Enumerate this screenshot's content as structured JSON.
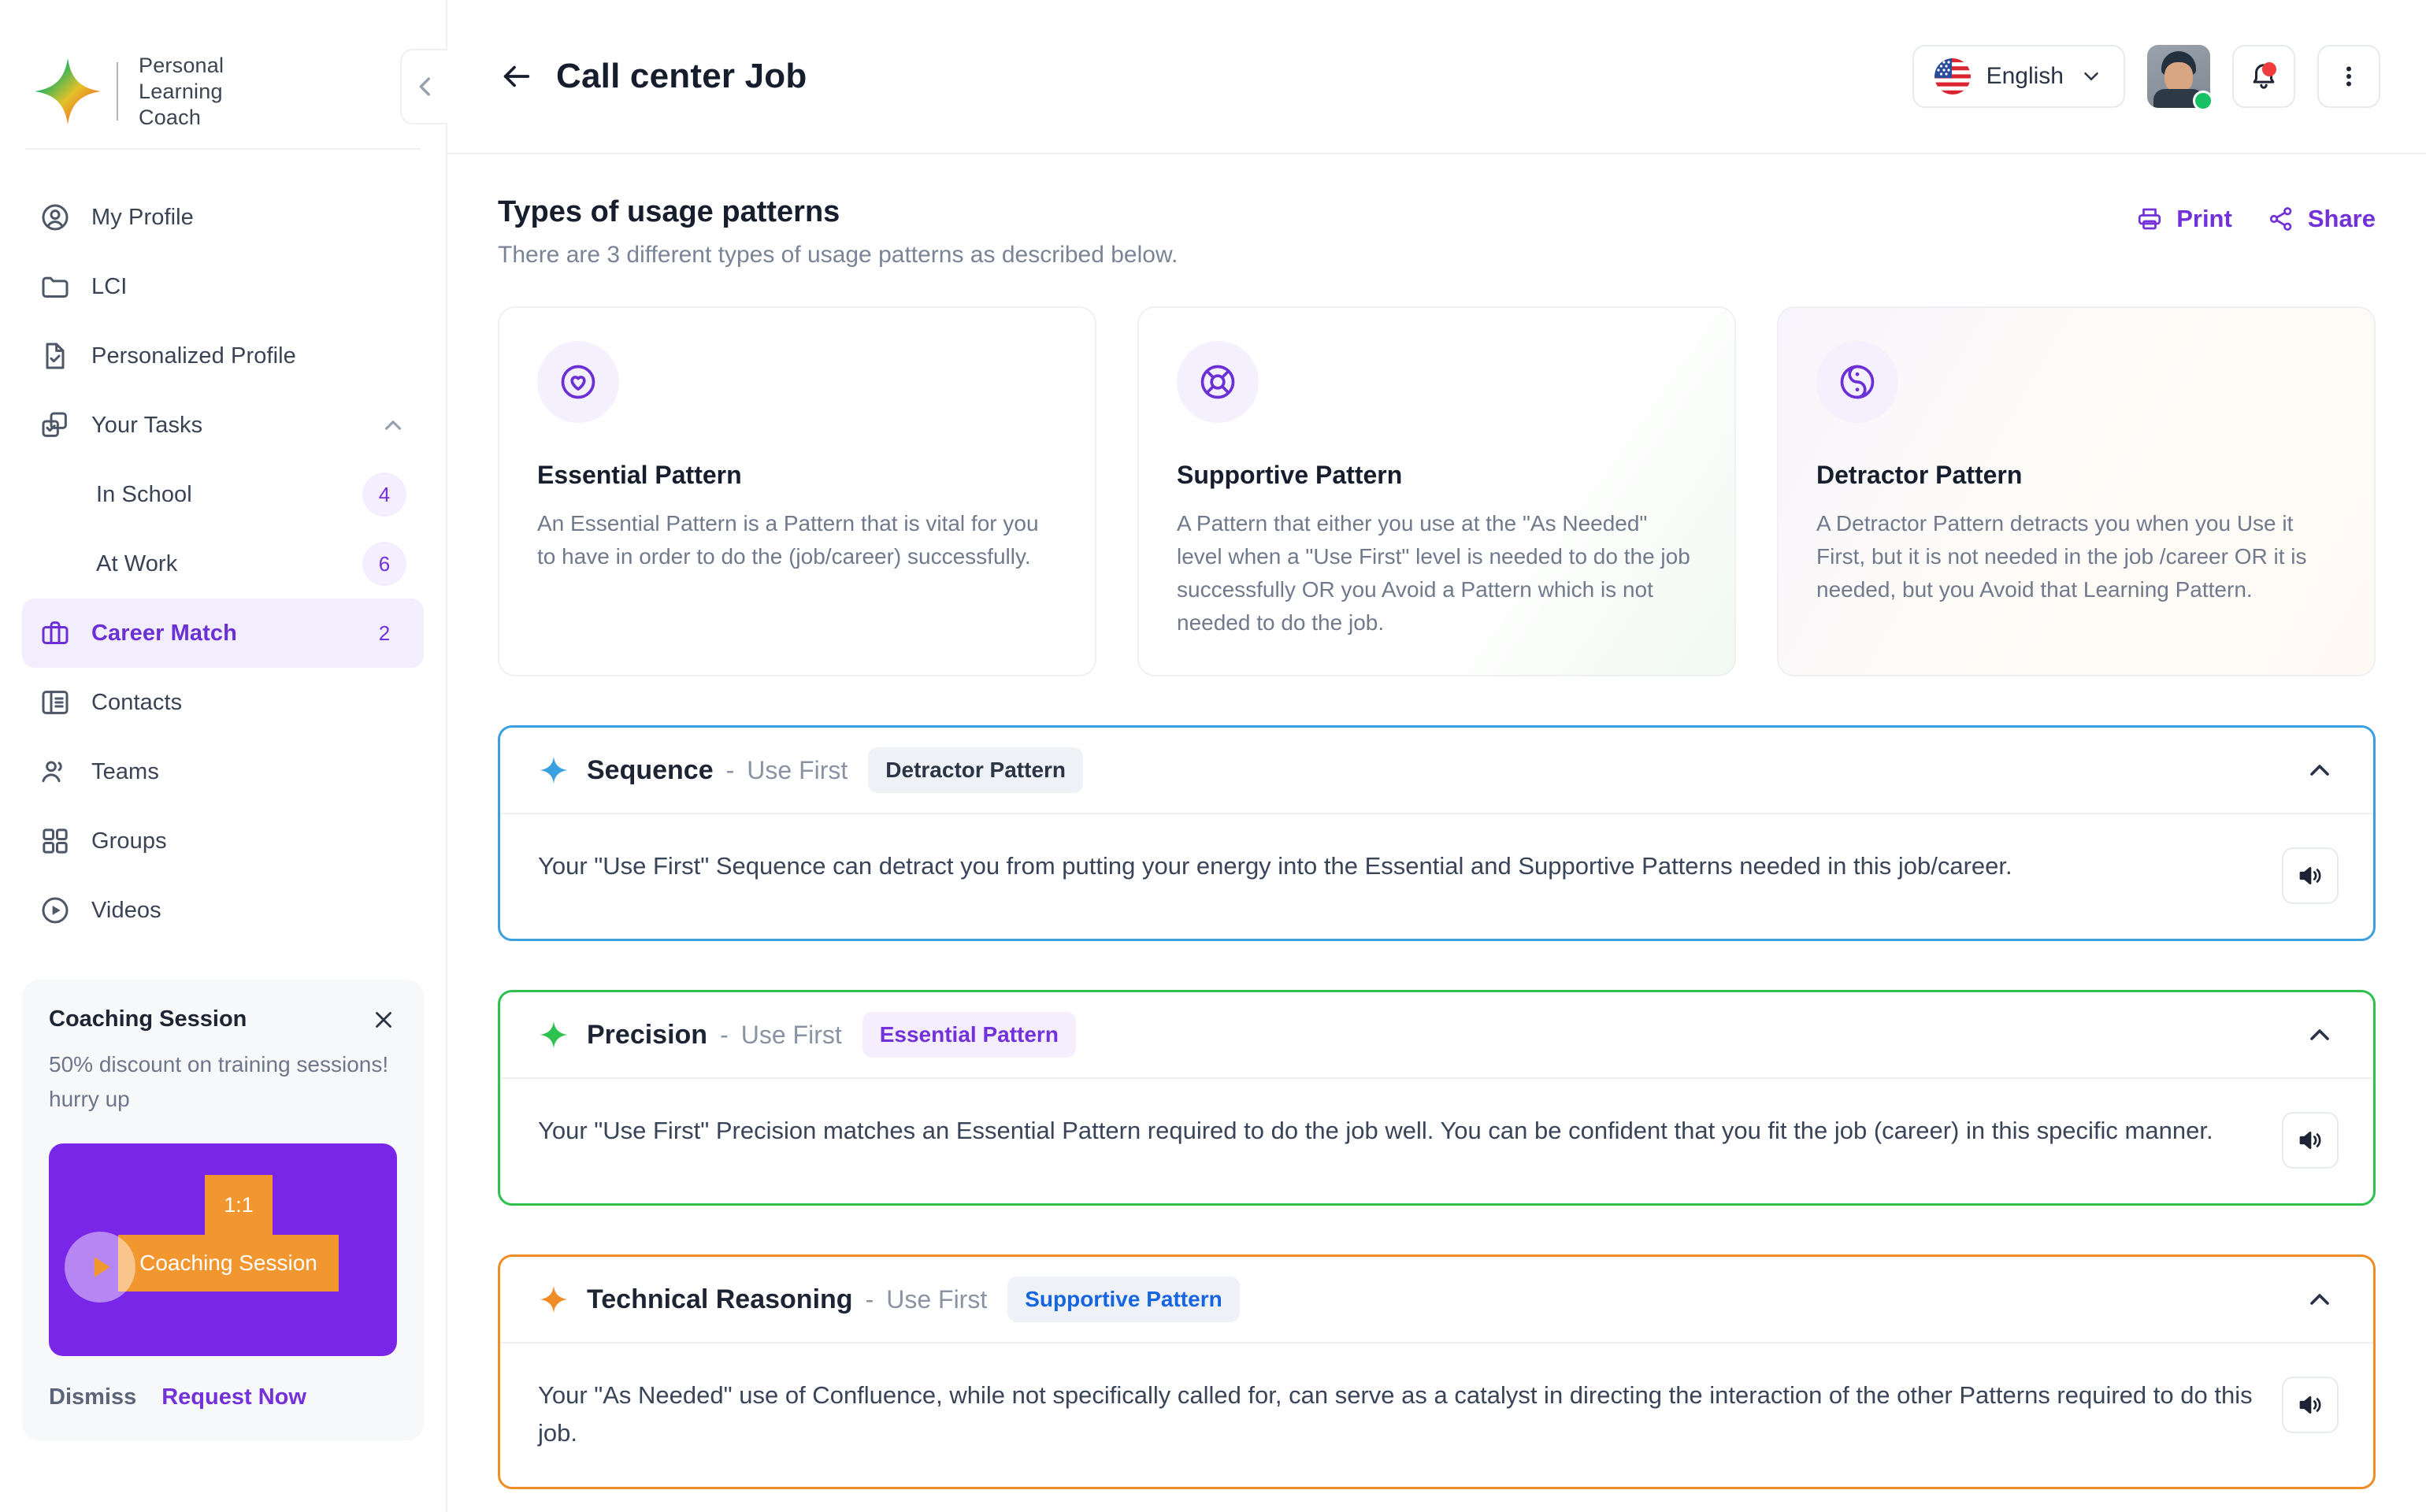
{
  "sidebar": {
    "brand": {
      "line1": "Personal",
      "line2": "Learning",
      "line3": "Coach",
      "logo_icon": "four-point-star-logo"
    },
    "collapse_icon": "chevron-left-icon",
    "items": [
      {
        "label": "My Profile",
        "icon": "user-circle-icon",
        "badge": ""
      },
      {
        "label": "LCI",
        "icon": "folder-icon",
        "badge": ""
      },
      {
        "label": "Personalized Profile",
        "icon": "document-check-icon",
        "badge": ""
      },
      {
        "label": "Your Tasks",
        "icon": "tasks-copy-icon",
        "badge": "",
        "chevron": "chevron-up-icon"
      },
      {
        "label": "In School",
        "icon": "",
        "badge": "4",
        "sub": true
      },
      {
        "label": "At Work",
        "icon": "",
        "badge": "6",
        "sub": true
      },
      {
        "label": "Career Match",
        "icon": "briefcase-icon",
        "badge": "2",
        "active": true
      },
      {
        "label": "Contacts",
        "icon": "contacts-book-icon",
        "badge": ""
      },
      {
        "label": "Teams",
        "icon": "users-icon",
        "badge": ""
      },
      {
        "label": "Groups",
        "icon": "grid-squares-icon",
        "badge": ""
      },
      {
        "label": "Videos",
        "icon": "play-circle-icon",
        "badge": ""
      }
    ],
    "coaching": {
      "title": "Coaching Session",
      "close_icon": "close-icon",
      "subtitle": "50% discount on training sessions! hurry up",
      "media": {
        "badge": "1:1",
        "caption": "Coaching Session",
        "play_icon": "play-icon"
      },
      "dismiss_label": "Dismiss",
      "request_label": "Request Now"
    }
  },
  "topbar": {
    "back_icon": "arrow-left-icon",
    "title": "Call center Job",
    "language": {
      "label": "English",
      "flag_icon": "us-flag-icon",
      "chevron_icon": "chevron-down-icon"
    },
    "avatar_icon": "user-avatar",
    "notifications_icon": "bell-icon",
    "more_icon": "more-vertical-icon"
  },
  "section": {
    "title": "Types of usage patterns",
    "subtitle": "There are 3 different types of usage patterns as described below.",
    "print_label": "Print",
    "print_icon": "printer-icon",
    "share_label": "Share",
    "share_icon": "share-nodes-icon"
  },
  "pattern_cards": [
    {
      "icon": "heart-circle-icon",
      "title": "Essential Pattern",
      "description": "An Essential Pattern is a Pattern that is vital for you to have in order to do the (job/career) successfully."
    },
    {
      "icon": "lifebuoy-icon",
      "title": "Supportive Pattern",
      "description": "A Pattern that either you use at the \"As Needed\" level when a \"Use First\" level is needed to do the job successfully OR you Avoid a Pattern which is not needed to do the job."
    },
    {
      "icon": "yin-yang-circle-icon",
      "title": "Detractor Pattern",
      "description": "A Detractor Pattern detracts you when you Use it First, but it is not needed in the job /career OR it is needed, but you Avoid that Learning Pattern."
    }
  ],
  "accordions": [
    {
      "name": "Sequence",
      "dash": "-",
      "level": "Use First",
      "badge": "Detractor Pattern",
      "badge_style": "grey",
      "star_icon": "sparkle-icon",
      "star_color": "#3aa0e0",
      "border_color": "#3aa0e0",
      "chevron_icon": "chevron-up-icon",
      "speaker_icon": "speaker-icon",
      "body": "Your \"Use First\" Sequence can detract you from putting your energy into the Essential and Supportive Patterns needed in this job/career."
    },
    {
      "name": "Precision",
      "dash": "-",
      "level": "Use First",
      "badge": "Essential Pattern",
      "badge_style": "purple",
      "star_icon": "sparkle-icon",
      "star_color": "#2ec14e",
      "border_color": "#2ec14e",
      "chevron_icon": "chevron-up-icon",
      "speaker_icon": "speaker-icon",
      "body": "Your \"Use First\" Precision matches an Essential Pattern required to do the job well. You can be confident that you fit the job (career) in this specific manner."
    },
    {
      "name": "Technical Reasoning",
      "dash": "-",
      "level": "Use First",
      "badge": "Supportive Pattern",
      "badge_style": "blue",
      "star_icon": "sparkle-icon",
      "star_color": "#f08c26",
      "border_color": "#f08c26",
      "chevron_icon": "chevron-up-icon",
      "speaker_icon": "speaker-icon",
      "body": "Your \"As Needed\" use of Confluence, while not specifically called for, can serve as a catalyst in directing the interaction of the other Patterns required to do this job."
    }
  ],
  "colors": {
    "accent_purple": "#7231d9",
    "blue": "#3aa0e0",
    "green": "#2ec14e",
    "orange": "#f08c26"
  }
}
